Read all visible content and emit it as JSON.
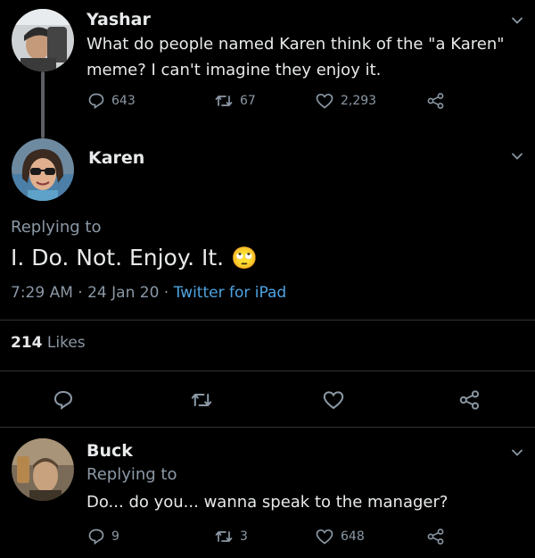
{
  "tweets": [
    {
      "author": "Yashar",
      "text": "What do people named Karen think of the \"a Karen\" meme? I can't imagine they enjoy it.",
      "replies": "643",
      "retweets": "67",
      "likes": "2,293"
    }
  ],
  "main": {
    "author": "Karen",
    "replying_label": "Replying to",
    "text": "I. Do. Not. Enjoy. It.",
    "emoji": "🙄",
    "time": "7:29 AM",
    "date": "24 Jan 20",
    "sep": "·",
    "source": "Twitter for iPad",
    "likes_count": "214",
    "likes_label": "Likes"
  },
  "reply": {
    "author": "Buck",
    "replying_label": "Replying to",
    "text": "Do... do you... wanna speak to the manager?",
    "replies": "9",
    "retweets": "3",
    "likes": "648"
  },
  "colors": {
    "background": "#000000",
    "text": "#e7e9ea",
    "muted": "#8b98a5",
    "link": "#4fa3e0",
    "divider": "#2f3336"
  }
}
